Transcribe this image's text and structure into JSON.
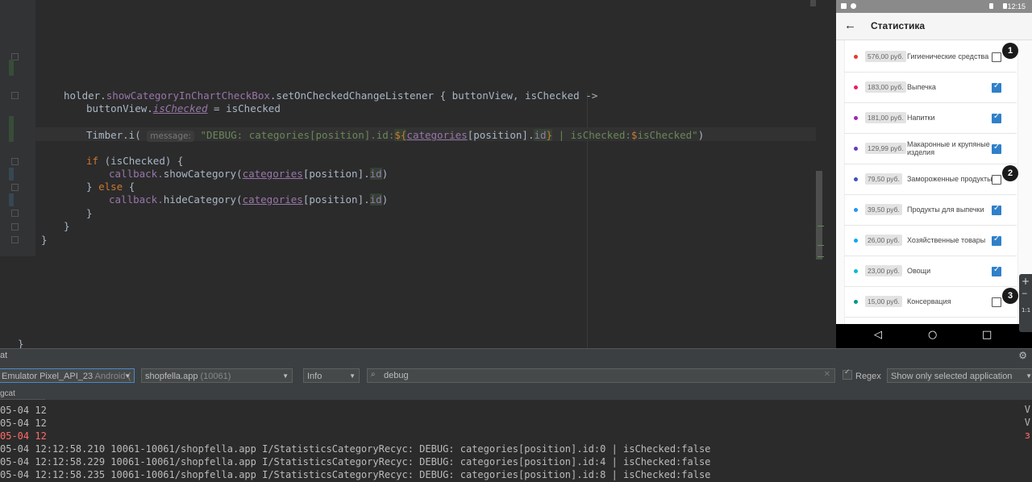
{
  "editor": {
    "code_lines": [
      {
        "id": "l1",
        "text": "holder.showCategoryInChartCheckBox.setOnCheckedChangeListener { buttonView, isChecked ->"
      },
      {
        "id": "l2",
        "text": "buttonView.isChecked = isChecked"
      },
      {
        "id": "l3",
        "text": "Timber.i( message: \"DEBUG: categories[position].id:${categories[position].id} | isChecked:$isChecked\")"
      },
      {
        "id": "l4",
        "text": "if (isChecked) {"
      },
      {
        "id": "l5",
        "text": "callback.showCategory(categories[position].id)"
      },
      {
        "id": "l6",
        "text": "} else {"
      },
      {
        "id": "l7",
        "text": "callback.hideCategory(categories[position].id)"
      },
      {
        "id": "l8",
        "text": "}"
      },
      {
        "id": "l9",
        "text": "}"
      },
      {
        "id": "l10",
        "text": "}"
      },
      {
        "id": "l11",
        "text": "}"
      }
    ],
    "tokens": {
      "holder": "holder.",
      "showCat": "showCategoryInChartCheckBox",
      "setListener": ".setOnCheckedChangeListener { buttonView, isChecked ->",
      "buttonView": "buttonView.",
      "isCheckedProp": "isChecked",
      "assign": " = isChecked",
      "timber": "Timber.i(",
      "hint": "message:",
      "str1": "\"DEBUG: categories[position].id:",
      "tmplOpen": "${",
      "categories": "categories",
      "posPart": "[position].",
      "id": "id",
      "tmplClose": "}",
      "str2": " | isChecked:",
      "dollar": "$",
      "str3": "isChecked\"",
      "close": ")",
      "if": "if",
      "ifCond": " (isChecked) {",
      "callback": "callback.",
      "show": "showCategory(",
      "hide": "hideCategory(",
      "idClose": ")",
      "closeBrace": "}",
      "elseOpen": "} ",
      "else": "else",
      "elseBrace": " {"
    }
  },
  "phone": {
    "status_time": "12:15",
    "title": "Статистика",
    "back_icon": "arrow-left-icon",
    "items": [
      {
        "price": "576,00 руб.",
        "name": "Гигиенические средства",
        "checked": false,
        "color": "#e53935",
        "badge": "1"
      },
      {
        "price": "183,00 руб.",
        "name": "Выпечка",
        "checked": true,
        "color": "#e91e63",
        "badge": ""
      },
      {
        "price": "181,00 руб.",
        "name": "Напитки",
        "checked": true,
        "color": "#9c27b0",
        "badge": ""
      },
      {
        "price": "129,99 руб.",
        "name": "Макаронные и крупяные изделия",
        "checked": true,
        "color": "#673ab7",
        "badge": ""
      },
      {
        "price": "79,50 руб.",
        "name": "Замороженные продукты",
        "checked": false,
        "color": "#3f51b5",
        "badge": "2"
      },
      {
        "price": "39,50 руб.",
        "name": "Продукты для выпечки",
        "checked": true,
        "color": "#2196f3",
        "badge": ""
      },
      {
        "price": "26,00 руб.",
        "name": "Хозяйственные товары",
        "checked": true,
        "color": "#03a9f4",
        "badge": ""
      },
      {
        "price": "23,00 руб.",
        "name": "Овощи",
        "checked": true,
        "color": "#00bcd4",
        "badge": ""
      },
      {
        "price": "15,00 руб.",
        "name": "Консервация",
        "checked": false,
        "color": "#009688",
        "badge": "3"
      }
    ],
    "nav": {
      "back": "◁",
      "home": "○",
      "recent": "□"
    },
    "side_tools": {
      "plus": "+",
      "minus": "−",
      "ratio": "1:1"
    }
  },
  "logcat": {
    "header_title": "at",
    "device": "Emulator Pixel_API_23",
    "device_suffix": "Android (",
    "process": "shopfella.app",
    "process_pid": "(10061)",
    "level": "Info",
    "search_value": "debug",
    "regex_label": "Regex",
    "filter": "Show only selected application",
    "tab_label": "gcat",
    "lines": [
      {
        "text": "05-04 12",
        "error": false,
        "tail": "V"
      },
      {
        "text": "05-04 12",
        "error": false,
        "tail": "V"
      },
      {
        "text": "05-04 12",
        "error": true,
        "tail": "з"
      },
      {
        "text": "05-04 12:12:58.210 10061-10061/shopfella.app I/StatisticsCategoryRecyc: DEBUG: categories[position].id:0 | isChecked:false",
        "error": false,
        "tail": ""
      },
      {
        "text": "05-04 12:12:58.229 10061-10061/shopfella.app I/StatisticsCategoryRecyc: DEBUG: categories[position].id:4 | isChecked:false",
        "error": false,
        "tail": ""
      },
      {
        "text": "05-04 12:12:58.235 10061-10061/shopfella.app I/StatisticsCategoryRecyc: DEBUG: categories[position].id:8 | isChecked:false",
        "error": false,
        "tail": ""
      }
    ]
  },
  "colors": {
    "editor_bg": "#2b2b2b",
    "keyword": "#cc7832",
    "property": "#9876aa",
    "string": "#6a8759",
    "checkbox_on": "#2f80c9",
    "log_error": "#ff6b68"
  }
}
